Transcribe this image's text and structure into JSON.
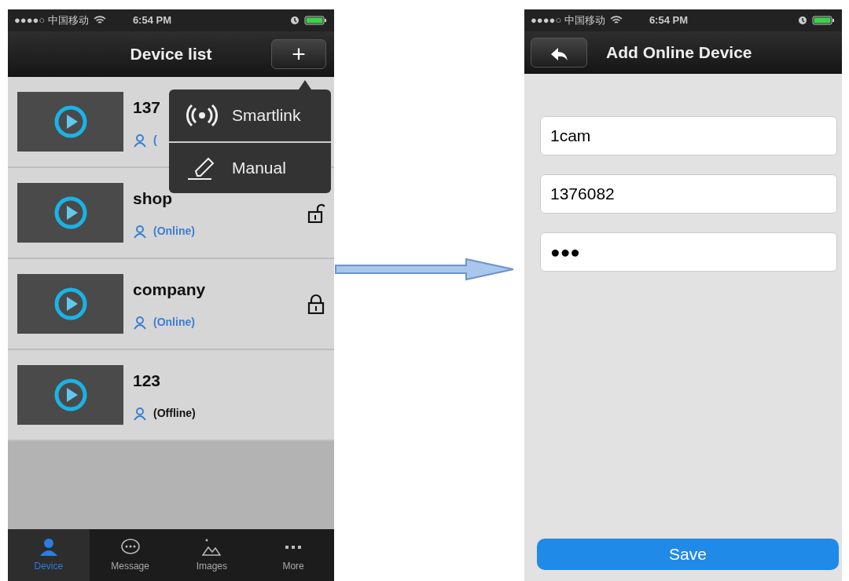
{
  "device_list_screen": {
    "status_bar": {
      "carrier": "●●●●○ 中国移动",
      "time": "6:54 PM"
    },
    "nav": {
      "title": "Device list",
      "add_button": "+"
    },
    "devices": [
      {
        "name": "137",
        "status": "(",
        "online": true
      },
      {
        "name": "shop",
        "status": "(Online)",
        "online": true,
        "locked": false
      },
      {
        "name": "company",
        "status": "(Online)",
        "online": true,
        "locked": true
      },
      {
        "name": "123",
        "status": "(Offline)",
        "online": false
      }
    ],
    "add_menu": [
      {
        "label": "Smartlink",
        "kind": "wireless"
      },
      {
        "label": "Manual",
        "kind": "pencil"
      }
    ],
    "tabs": [
      {
        "label": "Device",
        "selected": true
      },
      {
        "label": "Message",
        "selected": false
      },
      {
        "label": "Images",
        "selected": false
      },
      {
        "label": "More",
        "selected": false
      }
    ]
  },
  "add_device_screen": {
    "status_bar": {
      "carrier": "●●●●○ 中国移动",
      "time": "6:54 PM"
    },
    "nav": {
      "title": "Add Online Device"
    },
    "fields": [
      {
        "value": "1cam"
      },
      {
        "value": "1376082"
      },
      {
        "value": "●●●"
      }
    ],
    "save_button": "Save"
  }
}
